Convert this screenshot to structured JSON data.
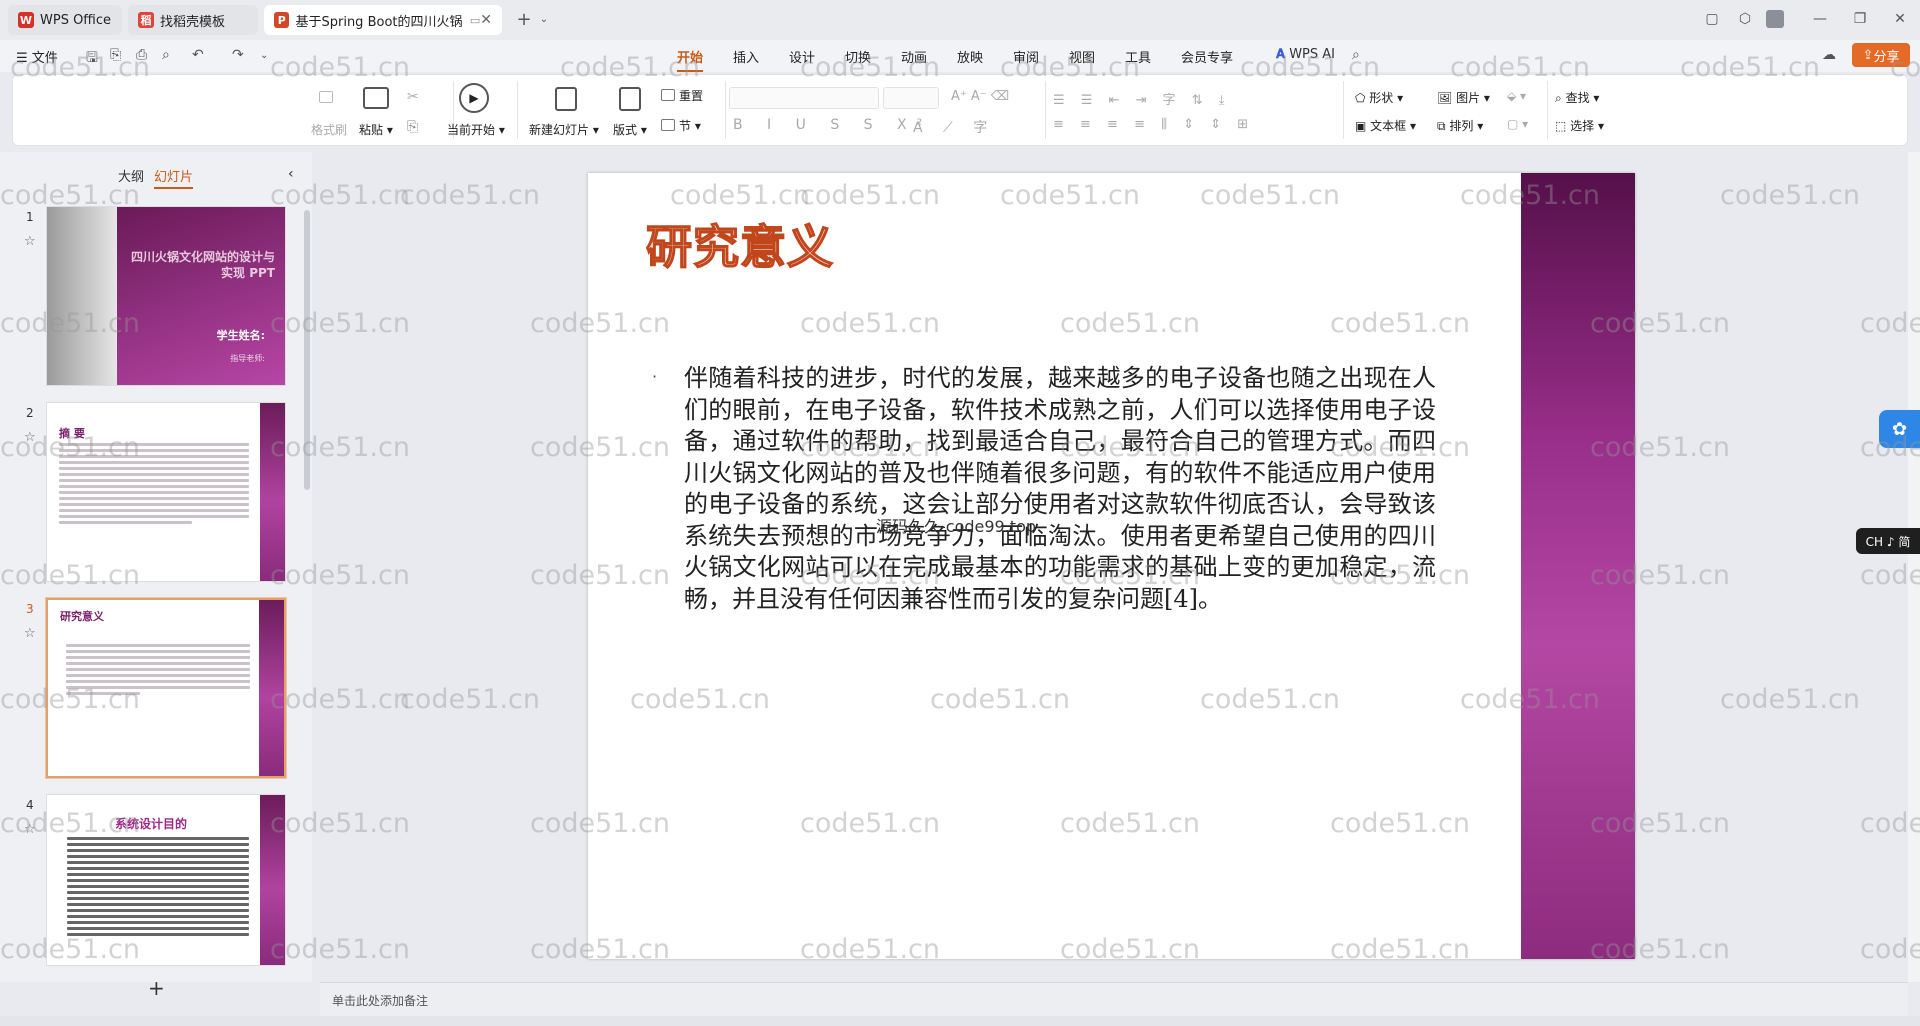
{
  "tabs": [
    {
      "label": "WPS Office",
      "icon": "wps-logo-icon",
      "icon_color": "#d93025",
      "active": false
    },
    {
      "label": "找稻壳模板",
      "icon": "docer-icon",
      "icon_color": "#e0433a",
      "active": false
    },
    {
      "label": "基于Spring Boot的四川火锅",
      "icon": "ppt-file-icon",
      "icon_color": "#d24726",
      "active": true
    }
  ],
  "menu": {
    "file": "文件",
    "items": [
      "开始",
      "插入",
      "设计",
      "切换",
      "动画",
      "放映",
      "审阅",
      "视图",
      "工具",
      "会员专享"
    ],
    "active": "开始",
    "ai_label": "WPS AI",
    "share": "分享"
  },
  "ribbon": {
    "format_painter": "格式刷",
    "paste": "粘贴",
    "play_from_current": "当前开始",
    "new_slide": "新建幻灯片",
    "layout": "版式",
    "reset": "重置",
    "section": "节",
    "shape": "形状",
    "picture": "图片",
    "textbox": "文本框",
    "arrange": "排列",
    "find": "查找",
    "select": "选择"
  },
  "panel": {
    "tab_outline": "大纲",
    "tab_slides": "幻灯片",
    "active_tab": "幻灯片"
  },
  "thumbnails": [
    {
      "number": "1",
      "title": "四川火锅文化网站的设计与实现 PPT",
      "student": "学生姓名:",
      "advisor": "指导老师:"
    },
    {
      "number": "2",
      "title": "摘 要"
    },
    {
      "number": "3",
      "title": "研究意义"
    },
    {
      "number": "4",
      "title": "系统设计目的"
    }
  ],
  "slide": {
    "title": "研究意义",
    "body": "伴随着科技的进步，时代的发展，越来越多的电子设备也随之出现在人们的眼前，在电子设备，软件技术成熟之前，人们可以选择使用电子设备，通过软件的帮助，找到最适合自己，最符合自己的管理方式。而四川火锅文化网站的普及也伴随着很多问题，有的软件不能适应用户使用的电子设备的系统，这会让部分使用者对这款软件彻底否认，会导致该系统失去预想的市场竞争力，面临淘汰。使用者更希望自己使用的四川火锅文化网站可以在完成最基本的功能需求的基础上变的更加稳定，流畅，并且没有任何因兼容性而引发的复杂问题[4]。",
    "center_watermark": "源码久久-code99.top",
    "accent_color": "#9b2f8c",
    "title_color": "#c2461b"
  },
  "notes_placeholder": "单击此处添加备注",
  "ime_badge": "CH ♪ 简",
  "watermark": "code51.cn"
}
